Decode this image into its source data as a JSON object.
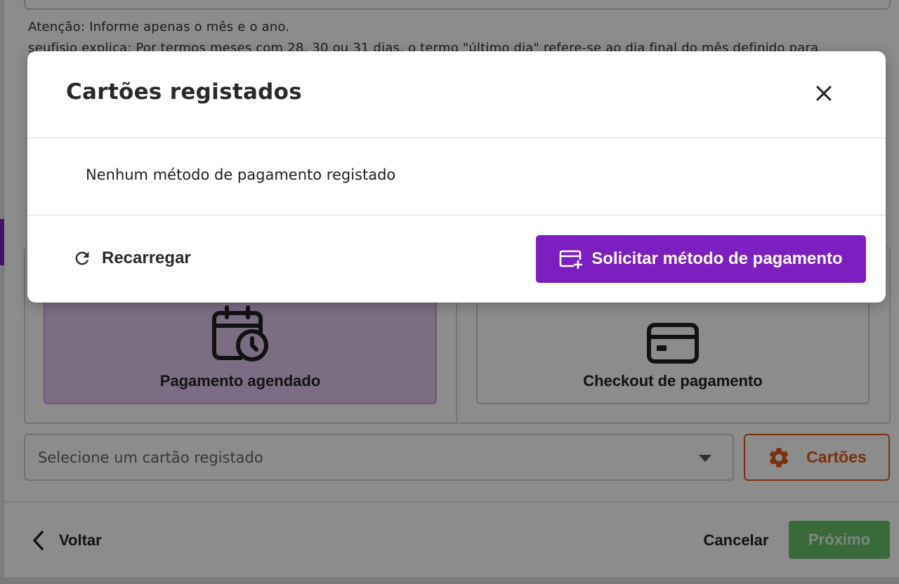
{
  "background": {
    "notice_line1": "Atenção: Informe apenas o mês e o ano.",
    "notice_line2": "seufisio explica: Por termos meses com 28, 30 ou 31 dias, o termo \"último dia\" refere-se ao dia final do mês definido para",
    "options": [
      {
        "label": "Pagamento agendado",
        "icon": "calendar-clock-icon",
        "selected": true
      },
      {
        "label": "Checkout de pagamento",
        "icon": "credit-card-icon",
        "selected": false
      }
    ],
    "card_select": {
      "placeholder": "Selecione um cartão registado"
    },
    "cards_button": {
      "label": "Cartões",
      "icon": "gear-icon"
    },
    "footer": {
      "back_label": "Voltar",
      "cancel_label": "Cancelar",
      "next_label": "Próximo"
    }
  },
  "modal": {
    "title": "Cartões registados",
    "empty_message": "Nenhum método de pagamento registado",
    "reload_label": "Recarregar",
    "request_label": "Solicitar método de pagamento"
  },
  "colors": {
    "primary_purple": "#7d1ec0",
    "accent_orange": "#e05a1a",
    "success_green": "#66c26a",
    "selected_card_bg": "#e2c6f2"
  }
}
